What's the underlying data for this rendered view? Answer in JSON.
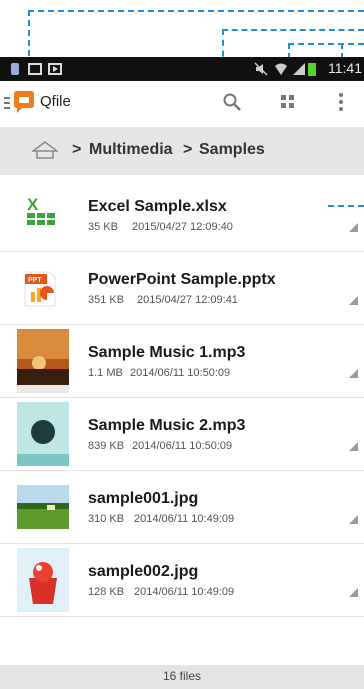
{
  "status_bar": {
    "time": "11:41"
  },
  "app_bar": {
    "title": "Qfile"
  },
  "breadcrumb": {
    "separator": ">",
    "items": [
      "Multimedia",
      "Samples"
    ]
  },
  "files": [
    {
      "name": "Excel Sample.xlsx",
      "size": "35 KB",
      "date": "2015/04/27 12:09:40",
      "icon": "excel-icon"
    },
    {
      "name": "PowerPoint Sample.pptx",
      "size": "351 KB",
      "date": "2015/04/27 12:09:41",
      "icon": "powerpoint-icon"
    },
    {
      "name": "Sample Music 1.mp3",
      "size": "1.1 MB",
      "date": "2014/06/11 10:50:09",
      "icon": "music-thumbnail"
    },
    {
      "name": "Sample Music 2.mp3",
      "size": "839 KB",
      "date": "2014/06/11 10:50:09",
      "icon": "music-thumbnail"
    },
    {
      "name": "sample001.jpg",
      "size": "310 KB",
      "date": "2014/06/11 10:49:09",
      "icon": "image-thumbnail"
    },
    {
      "name": "sample002.jpg",
      "size": "128 KB",
      "date": "2014/06/11 10:49:09",
      "icon": "image-thumbnail"
    }
  ],
  "footer": {
    "count": "16 files"
  },
  "colors": {
    "accent": "#f07d1a",
    "callout": "#1f8fe0",
    "breadcrumb_bg": "#e6e6e6"
  }
}
